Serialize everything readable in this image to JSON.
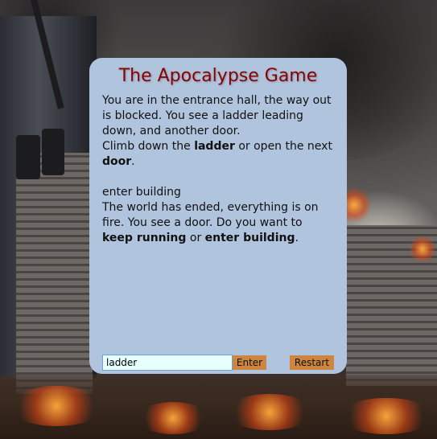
{
  "game": {
    "title": "The Apocalypse Game"
  },
  "story": {
    "lines": [
      {
        "segments": [
          {
            "text": "You are in the entrance hall, the way out is blocked. You see a ladder leading down, and another door.",
            "bold": false
          }
        ]
      },
      {
        "segments": [
          {
            "text": "Climb down the ",
            "bold": false
          },
          {
            "text": "ladder",
            "bold": true
          },
          {
            "text": " or open the next ",
            "bold": false
          },
          {
            "text": "door",
            "bold": true
          },
          {
            "text": ".",
            "bold": false
          }
        ]
      },
      {
        "segments": []
      },
      {
        "segments": [
          {
            "text": "enter building",
            "bold": false
          }
        ]
      },
      {
        "segments": [
          {
            "text": "The world has ended, everything is on fire. You see a door. Do you want to ",
            "bold": false
          },
          {
            "text": "keep running",
            "bold": true
          },
          {
            "text": " or ",
            "bold": false
          },
          {
            "text": "enter building",
            "bold": true
          },
          {
            "text": ".",
            "bold": false
          }
        ]
      }
    ]
  },
  "controls": {
    "input_value": "ladder",
    "enter_label": "Enter",
    "restart_label": "Restart"
  },
  "colors": {
    "panel": "#b0c4de",
    "title": "#8b0000",
    "button": "#cd853f",
    "input_bg": "#e6ffff"
  }
}
